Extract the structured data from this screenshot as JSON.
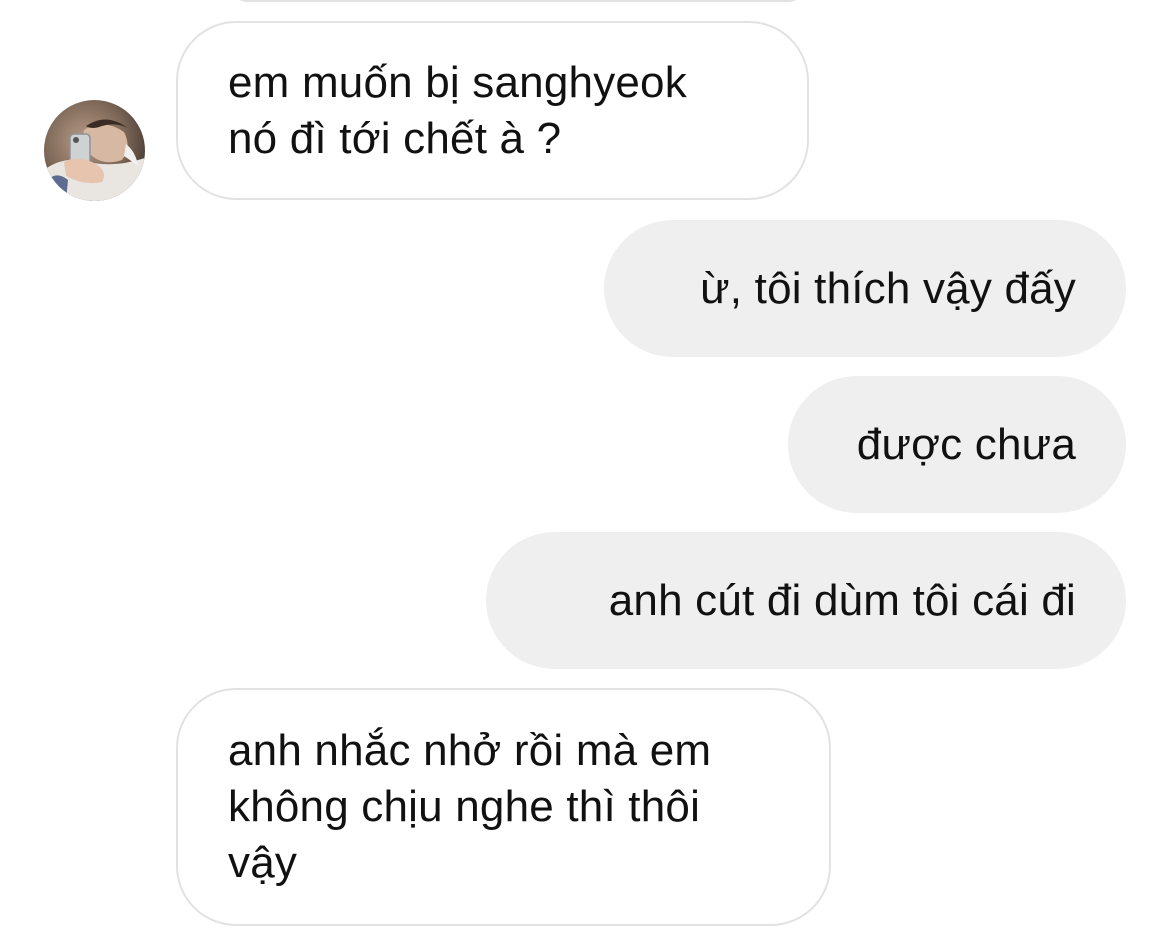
{
  "conversation": {
    "contact_avatar": "contact-avatar-photo",
    "messages": [
      {
        "direction": "incoming",
        "text": "em muốn bị sanghyeok\nnó đì tới chết à ?"
      },
      {
        "direction": "outgoing",
        "text": "ừ, tôi thích vậy đấy"
      },
      {
        "direction": "outgoing",
        "text": "được chưa"
      },
      {
        "direction": "outgoing",
        "text": "anh cút đi dùm tôi cái đi"
      },
      {
        "direction": "incoming",
        "text": "anh nhắc nhở rồi mà em\nkhông chịu nghe thì thôi\nvậy"
      }
    ]
  },
  "colors": {
    "incoming_bg": "#ffffff",
    "incoming_border": "#e2e2e2",
    "outgoing_bg": "#efefef",
    "text": "#111111"
  }
}
